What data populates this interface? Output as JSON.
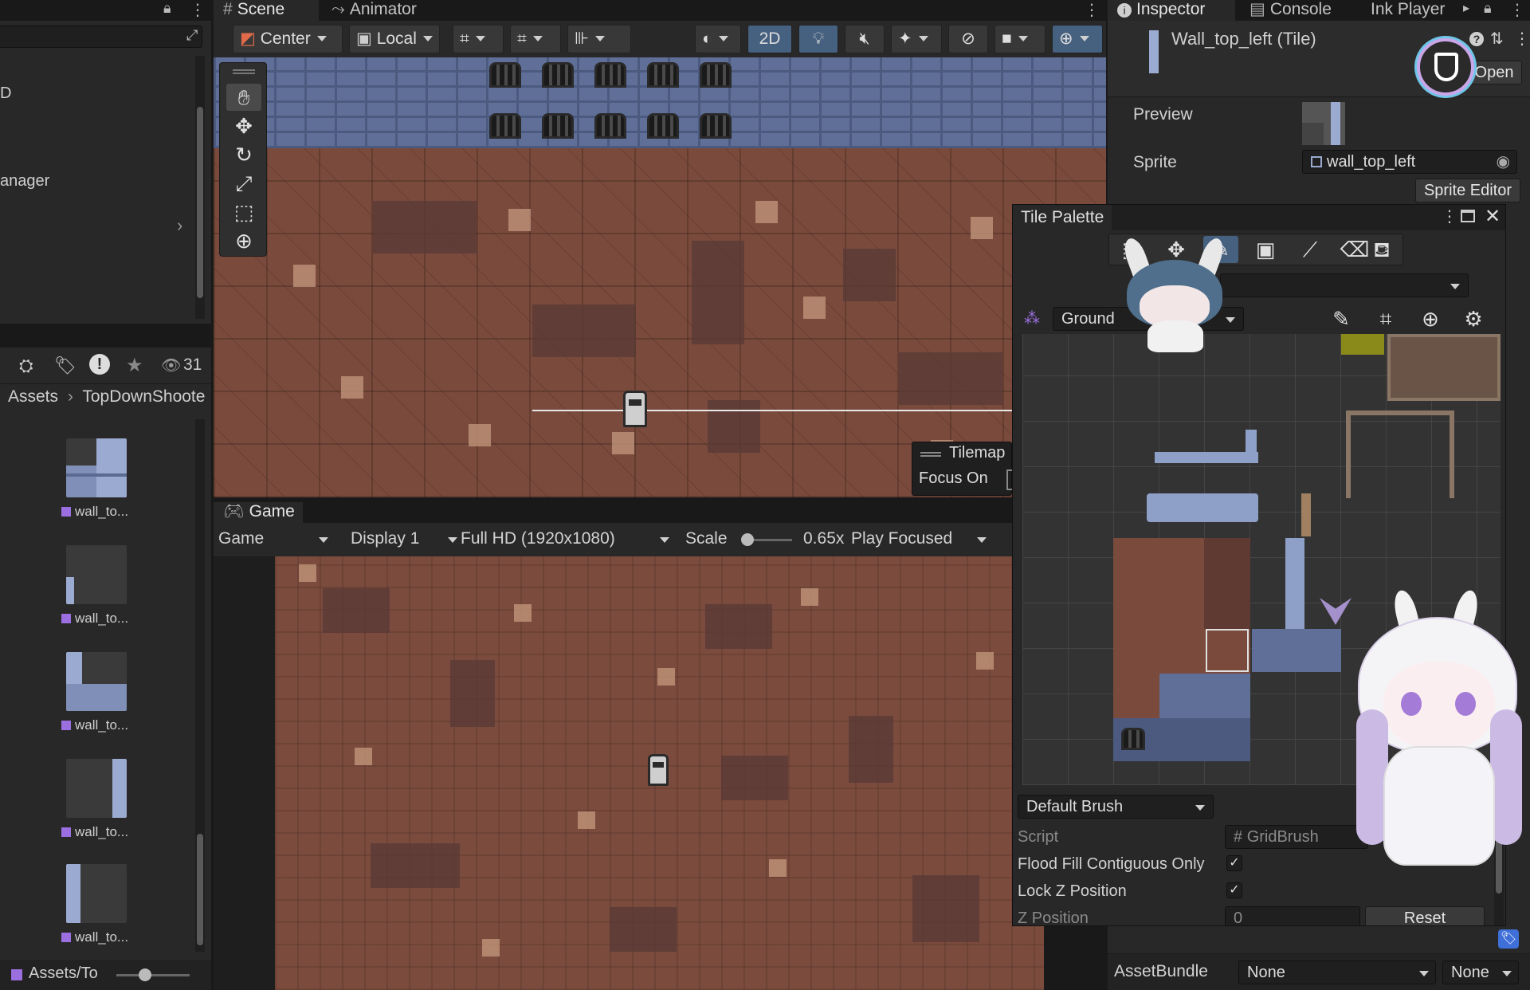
{
  "window": {
    "tabs": {
      "scene": "Scene",
      "animator": "Animator",
      "game": "Game",
      "inspector": "Inspector",
      "console": "Console",
      "ink_player": "Ink Player"
    }
  },
  "hierarchy": {
    "items": [
      "D",
      "anager"
    ],
    "eye_count": "31"
  },
  "project": {
    "breadcrumb": [
      "Assets",
      "TopDownShoote"
    ],
    "assets": [
      "wall_to...",
      "wall_to...",
      "wall_to...",
      "wall_to...",
      "wall_to..."
    ],
    "bottom_path": "Assets/To"
  },
  "scene_toolbar": {
    "pivot": "Center",
    "space": "Local",
    "mode_2d": "2D"
  },
  "scene_overlay": {
    "tilemap": "Tilemap",
    "focus_on": "Focus On"
  },
  "game_toolbar": {
    "mode": "Game",
    "display": "Display 1",
    "resolution": "Full HD (1920x1080)",
    "scale_label": "Scale",
    "scale_value": "0.65x",
    "play_focused": "Play Focused"
  },
  "inspector": {
    "title": "Wall_top_left (Tile)",
    "open_button": "Open",
    "preview_label": "Preview",
    "sprite_label": "Sprite",
    "sprite_value": "wall_top_left",
    "sprite_editor_button": "Sprite Editor",
    "asset_bundle_label": "AssetBundle",
    "asset_bundle_value": "None",
    "asset_bundle_variant": "None"
  },
  "tile_palette": {
    "title": "Tile Palette",
    "palette_name": "Ground",
    "brush": "Default Brush",
    "script_label": "Script",
    "script_value": "GridBrush",
    "flood_fill_label": "Flood Fill Contiguous Only",
    "flood_fill_checked": true,
    "lock_z_label": "Lock Z Position",
    "lock_z_checked": true,
    "z_position_label": "Z Position",
    "z_position_value": "0",
    "reset_button": "Reset"
  },
  "colors": {
    "panel_bg": "#282828",
    "window_bg": "#191919",
    "accent_blue": "#46607f",
    "floor_brown": "#7a4a3c",
    "wall_blue": "#5f6f98"
  }
}
